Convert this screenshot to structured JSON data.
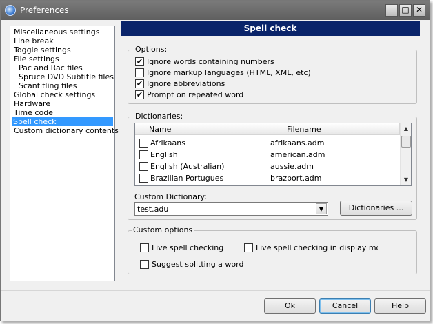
{
  "window": {
    "title": "Preferences"
  },
  "nav": {
    "items": [
      {
        "label": "Miscellaneous settings",
        "indent": false,
        "selected": false
      },
      {
        "label": "Line break",
        "indent": false,
        "selected": false
      },
      {
        "label": "Toggle settings",
        "indent": false,
        "selected": false
      },
      {
        "label": "File settings",
        "indent": false,
        "selected": false
      },
      {
        "label": "Pac and Rac files",
        "indent": true,
        "selected": false
      },
      {
        "label": "Spruce DVD Subtitle files",
        "indent": true,
        "selected": false
      },
      {
        "label": "Scantitling files",
        "indent": true,
        "selected": false
      },
      {
        "label": "Global check settings",
        "indent": false,
        "selected": false
      },
      {
        "label": "Hardware",
        "indent": false,
        "selected": false
      },
      {
        "label": "Time code",
        "indent": false,
        "selected": false
      },
      {
        "label": "Spell check",
        "indent": false,
        "selected": true
      },
      {
        "label": "Custom dictionary contents",
        "indent": false,
        "selected": false
      }
    ]
  },
  "panel": {
    "header": "Spell check"
  },
  "options": {
    "label": "Options:",
    "items": [
      {
        "label": "Ignore words containing numbers",
        "checked": true
      },
      {
        "label": "Ignore markup languages (HTML, XML, etc)",
        "checked": false
      },
      {
        "label": "Ignore abbreviations",
        "checked": true
      },
      {
        "label": "Prompt on repeated word",
        "checked": true
      }
    ]
  },
  "dictionaries": {
    "label": "Dictionaries:",
    "columns": {
      "name": "Name",
      "filename": "Filename"
    },
    "rows": [
      {
        "name": "Afrikaans",
        "filename": "afrikaans.adm",
        "checked": false
      },
      {
        "name": "English",
        "filename": "american.adm",
        "checked": false
      },
      {
        "name": "English (Australian)",
        "filename": "aussie.adm",
        "checked": false
      },
      {
        "name": "Brazilian Portugues",
        "filename": "brazport.adm",
        "checked": false
      }
    ],
    "custom_label": "Custom Dictionary:",
    "custom_value": "test.adu",
    "dictionaries_button": "Dictionaries ..."
  },
  "custom_options": {
    "label": "Custom options",
    "live_spell": "Live spell checking",
    "live_spell_display": "Live spell checking in display mode",
    "suggest_split": "Suggest splitting a word"
  },
  "buttons": {
    "ok": "Ok",
    "cancel": "Cancel",
    "help": "Help"
  },
  "icons": {
    "check": "✔",
    "dropdown": "▼",
    "scroll_up": "▲",
    "scroll_down": "▼"
  }
}
